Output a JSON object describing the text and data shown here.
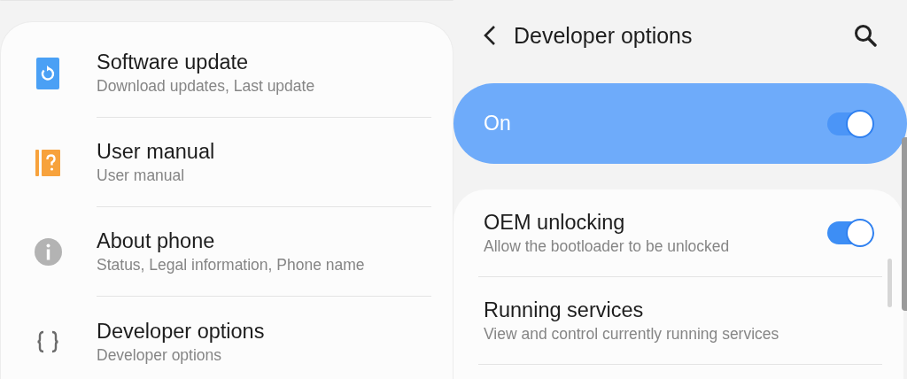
{
  "settings_list": {
    "items": [
      {
        "kind": "update",
        "title": "Software update",
        "subtitle": "Download updates, Last update"
      },
      {
        "kind": "manual",
        "title": "User manual",
        "subtitle": "User manual"
      },
      {
        "kind": "info",
        "title": "About phone",
        "subtitle": "Status, Legal information, Phone name"
      },
      {
        "kind": "code",
        "title": "Developer options",
        "subtitle": "Developer options"
      }
    ]
  },
  "developer_options": {
    "title": "Developer options",
    "master_switch": {
      "label": "On",
      "on": true
    },
    "items": [
      {
        "kind": "toggle",
        "title": "OEM unlocking",
        "subtitle": "Allow the bootloader to be unlocked",
        "on": true
      },
      {
        "kind": "plain",
        "title": "Running services",
        "subtitle": "View and control currently running services"
      }
    ]
  }
}
